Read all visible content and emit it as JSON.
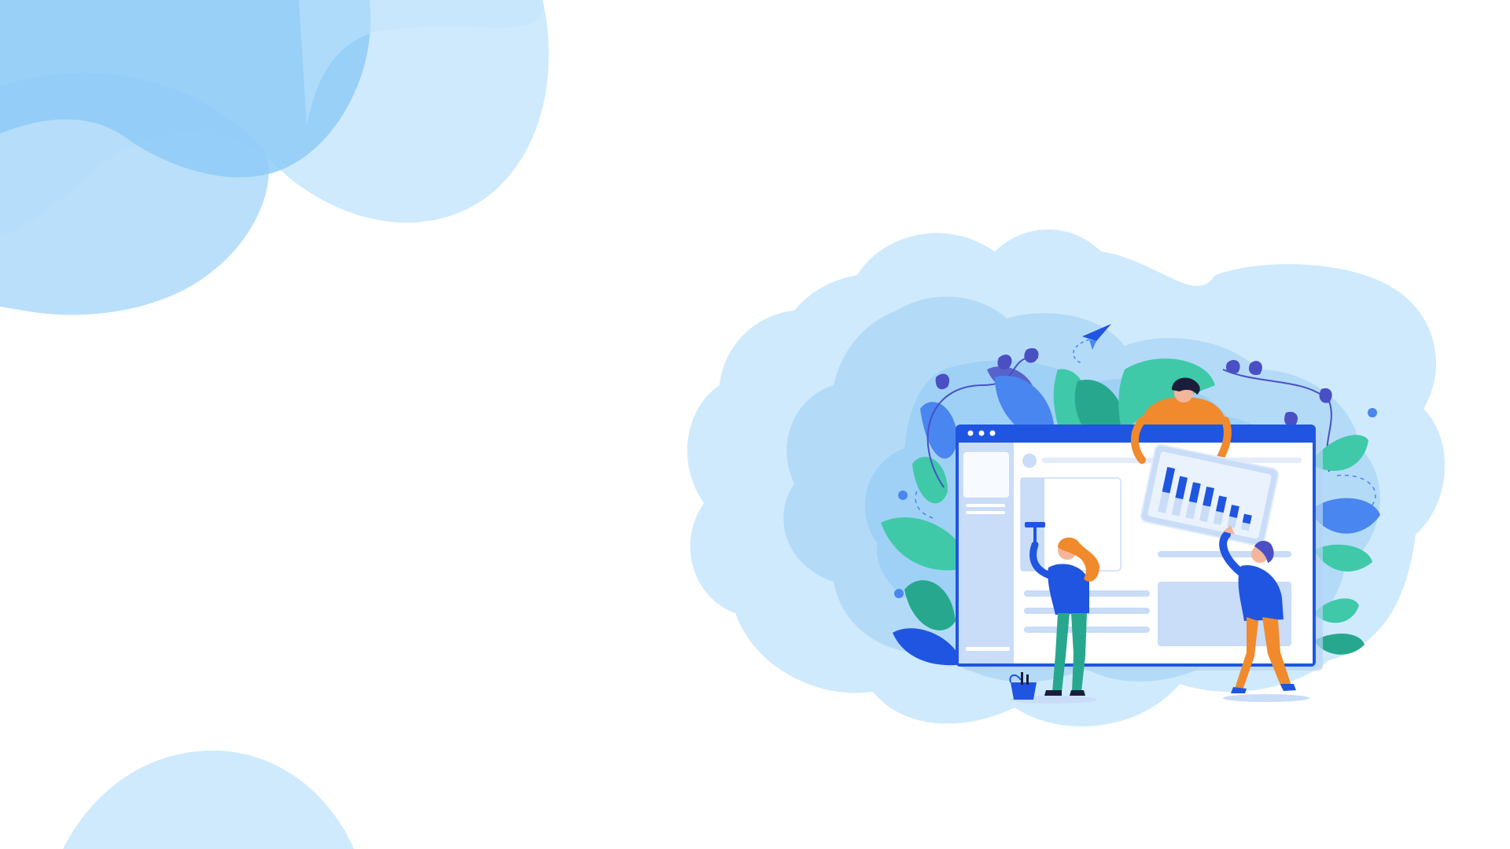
{
  "background": {
    "color": "#ffffff",
    "blob_colors": [
      "#8ecbf7",
      "#aedcf9",
      "#cfeafc"
    ]
  },
  "illustration": {
    "subject": "team-building-website",
    "people_count": 3,
    "palette": {
      "blue_primary": "#1f55e0",
      "blue_mid": "#4a86f0",
      "blue_light": "#c9dcf8",
      "orange": "#f08a2c",
      "teal": "#3fc9a8",
      "teal_dark": "#27a88e",
      "purple": "#4a4fc4",
      "skin": "#f4b59a"
    },
    "chart_card_bar_count": 7
  }
}
